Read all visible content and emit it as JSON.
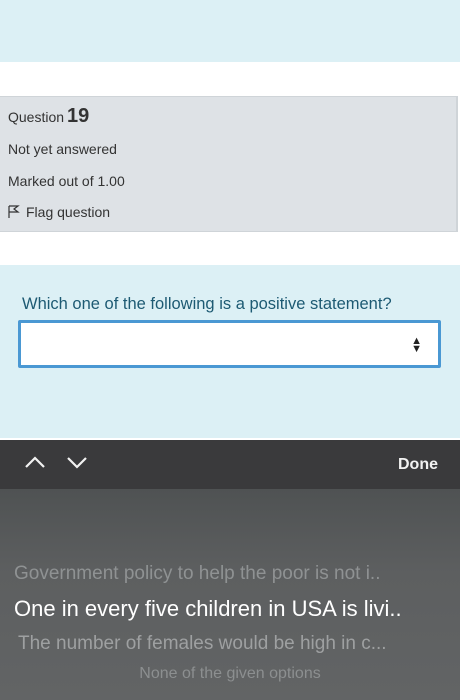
{
  "question": {
    "prefix": "Question",
    "number": "19",
    "status": "Not yet answered",
    "marks": "Marked out of 1.00",
    "flag_label": "Flag question",
    "text": "Which one of the following is a positive statement?",
    "select_value": ""
  },
  "picker": {
    "done_label": "Done",
    "options": [
      "Government policy to help the poor is not i..",
      "One in every five children in USA is livi..",
      "The number of females would be high in c...",
      "None of the given options"
    ],
    "selected_index": 1
  },
  "colors": {
    "accent": "#4a98d3",
    "question_text": "#1d5a73",
    "panel": "#dcf0f5"
  }
}
